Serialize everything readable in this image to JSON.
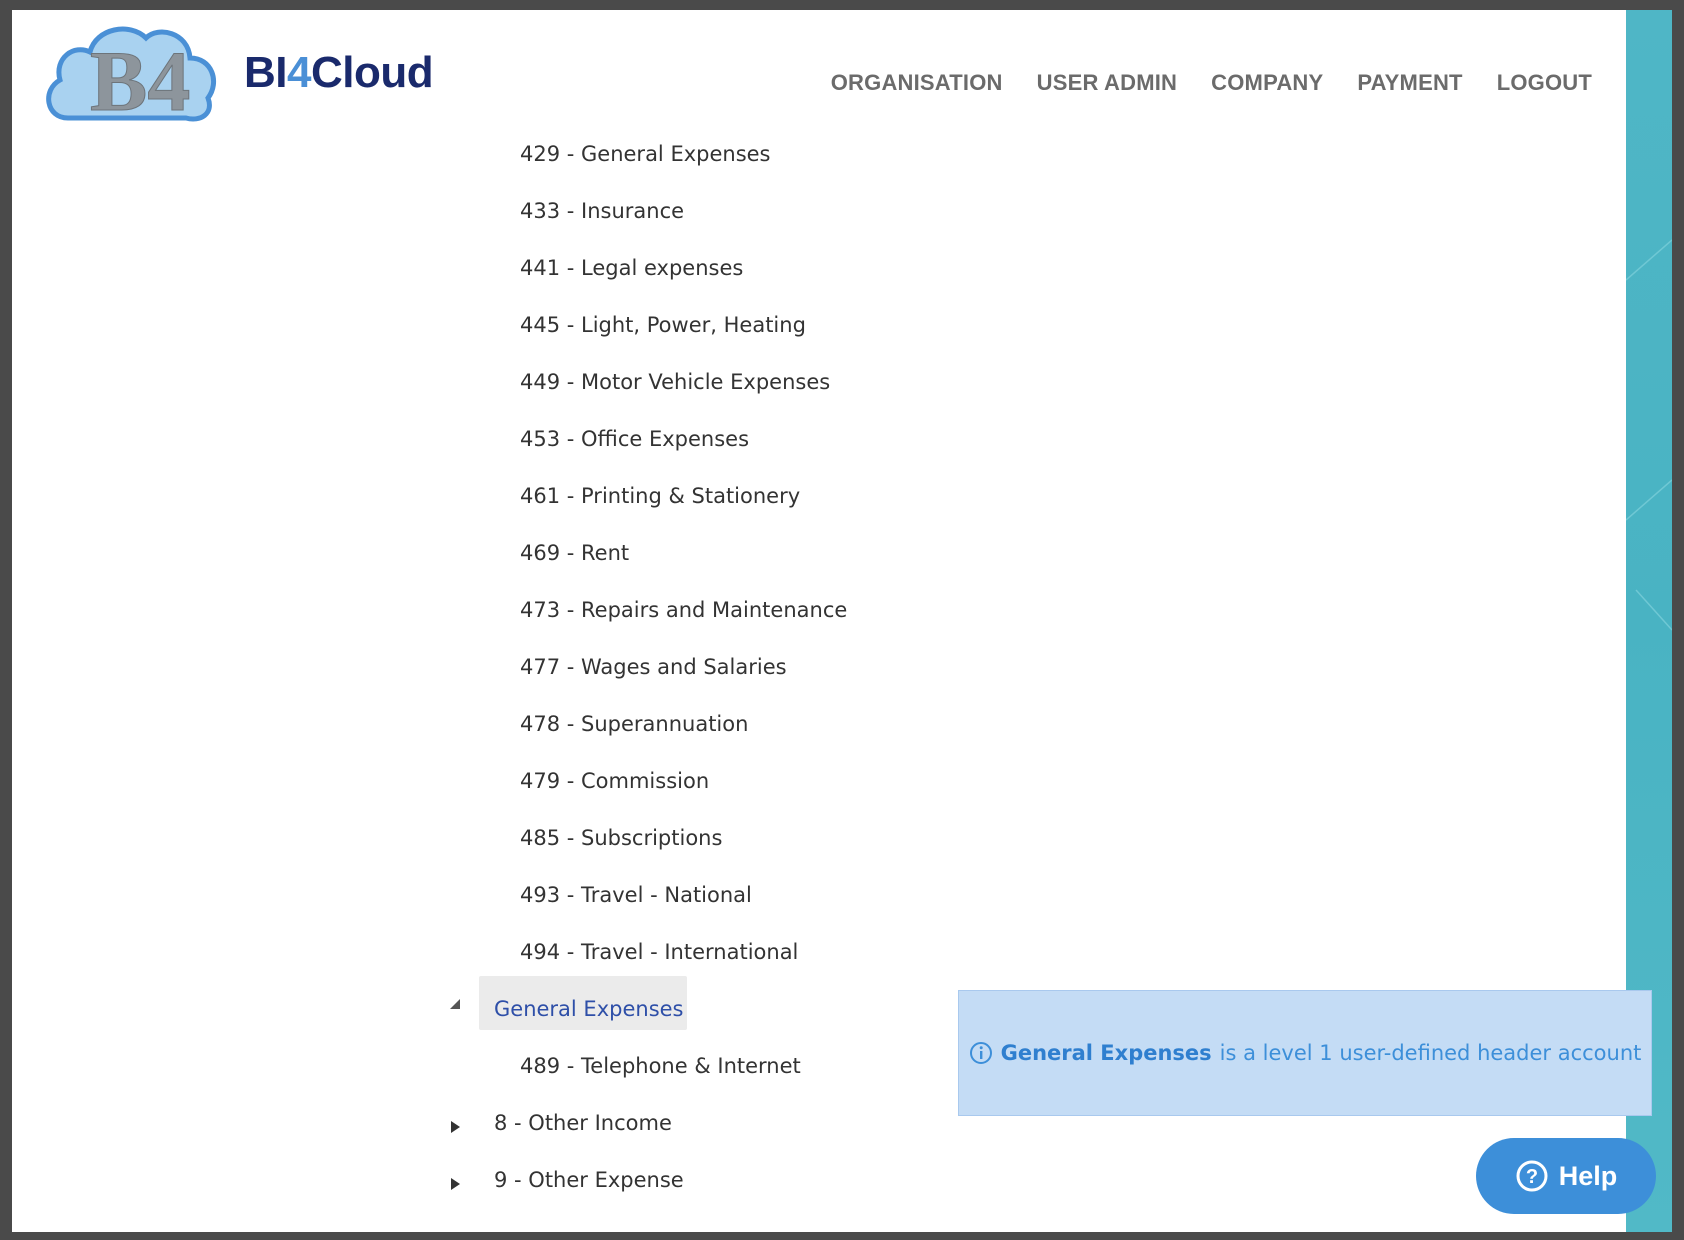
{
  "brand": {
    "name_prefix": "BI",
    "name_digit": "4",
    "name_suffix": "Cloud",
    "logo_text": "B4"
  },
  "nav": {
    "items": [
      "ORGANISATION",
      "USER ADMIN",
      "COMPANY",
      "PAYMENT",
      "LOGOUT"
    ]
  },
  "tree": {
    "children_before": [
      "429 - General Expenses",
      "433 - Insurance",
      "441 - Legal expenses",
      "445 - Light, Power, Heating",
      "449 - Motor Vehicle Expenses",
      "453 - Office Expenses",
      "461 - Printing & Stationery",
      "469 - Rent",
      "473 - Repairs and Maintenance",
      "477 - Wages and Salaries",
      "478 - Superannuation",
      "479 - Commission",
      "485 - Subscriptions",
      "493 - Travel - National",
      "494 - Travel - International"
    ],
    "selected_node": {
      "label": "General Expenses",
      "expanded": true
    },
    "selected_children": [
      "489 - Telephone & Internet"
    ],
    "collapsed_nodes": [
      "8 - Other Income",
      "9 - Other Expense"
    ]
  },
  "info": {
    "icon": "info-circle-icon",
    "highlight": "General Expenses",
    "message": "is a level 1 user-defined header account"
  },
  "help": {
    "label": "Help",
    "icon": "question-circle-icon"
  },
  "colors": {
    "brand_dark": "#1a2a6c",
    "brand_accent": "#4a8fd6",
    "teal": "#4fb6c6",
    "info_bg": "#c4dcf5",
    "help_bg": "#3d8fd9"
  }
}
